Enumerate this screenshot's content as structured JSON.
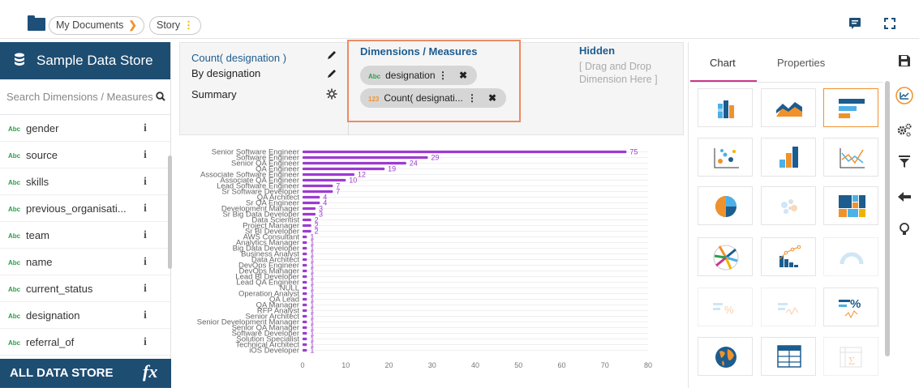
{
  "breadcrumb": {
    "documents": "My Documents",
    "story": "Story"
  },
  "sidebar": {
    "title": "Sample Data Store",
    "search_placeholder": "Search Dimensions / Measures",
    "type_label": "Abc",
    "info_label": "i",
    "fields": [
      "gender",
      "source",
      "skills",
      "previous_organisati...",
      "team",
      "name",
      "current_status",
      "designation",
      "referral_of"
    ],
    "footer": "ALL DATA STORE",
    "footer_icon": "fx"
  },
  "properties": {
    "count_label": "Count( designation )",
    "by_label": "By designation",
    "summary_label": "Summary"
  },
  "dimensions_measures": {
    "title": "Dimensions / Measures",
    "chips": [
      {
        "type": "Abc",
        "label": "designation"
      },
      {
        "type": "123",
        "label": "Count( designati..."
      }
    ]
  },
  "hidden": {
    "title": "Hidden",
    "placeholder": "[ Drag and Drop Dimension Here ]"
  },
  "panel": {
    "tabs": [
      "Chart",
      "Properties"
    ]
  },
  "colors": {
    "accent": "#f0922b",
    "bar": "#9c3bd0",
    "brand": "#1e4d72"
  },
  "chart_data": {
    "type": "bar",
    "orientation": "horizontal",
    "categories": [
      "Senior Software Engineer",
      "Software Engineer",
      "Senior QA Engineer",
      "QA Engineer",
      "Associate Software Engineer",
      "Associate QA Engineer",
      "Lead Software Engineer",
      "Sr Software Developer",
      "QA Architect",
      "Sr QA Engineer",
      "Development Manager",
      "Sr Big Data Developer",
      "Data Scientist",
      "Project Manager",
      "Sr BI Developer",
      "AWS Consultant",
      "Analytics Manager",
      "Big Data Developer",
      "Business Analyst",
      "Data Architect",
      "DevOps Engineer",
      "DevOps Manager",
      "Lead BI Developer",
      "Lead QA Engineer",
      "NULL",
      "Operation Analyst",
      "QA Lead",
      "QA Manager",
      "RFP Analyst",
      "Senior Architect",
      "Senior Development Manager",
      "Senior QA Manager",
      "Software Developer",
      "Solution Specialist",
      "Technical Architect",
      "iOS Developer"
    ],
    "values": [
      75,
      29,
      24,
      19,
      12,
      10,
      7,
      7,
      4,
      4,
      3,
      3,
      2,
      2,
      2,
      1,
      1,
      1,
      1,
      1,
      1,
      1,
      1,
      1,
      1,
      1,
      1,
      1,
      1,
      1,
      1,
      1,
      1,
      1,
      1,
      1
    ],
    "labeled_values": [
      75,
      29,
      24,
      19,
      12,
      10,
      7,
      7,
      4,
      4,
      3,
      3,
      2,
      2,
      2,
      1,
      1,
      1,
      1,
      1,
      1,
      1,
      1,
      1,
      1,
      1,
      1,
      1,
      1,
      1,
      1,
      1,
      1,
      1,
      1,
      1
    ],
    "xlim": [
      0,
      80
    ],
    "xticks": [
      0,
      10,
      20,
      30,
      40,
      50,
      60,
      70,
      80
    ],
    "grid": true
  }
}
